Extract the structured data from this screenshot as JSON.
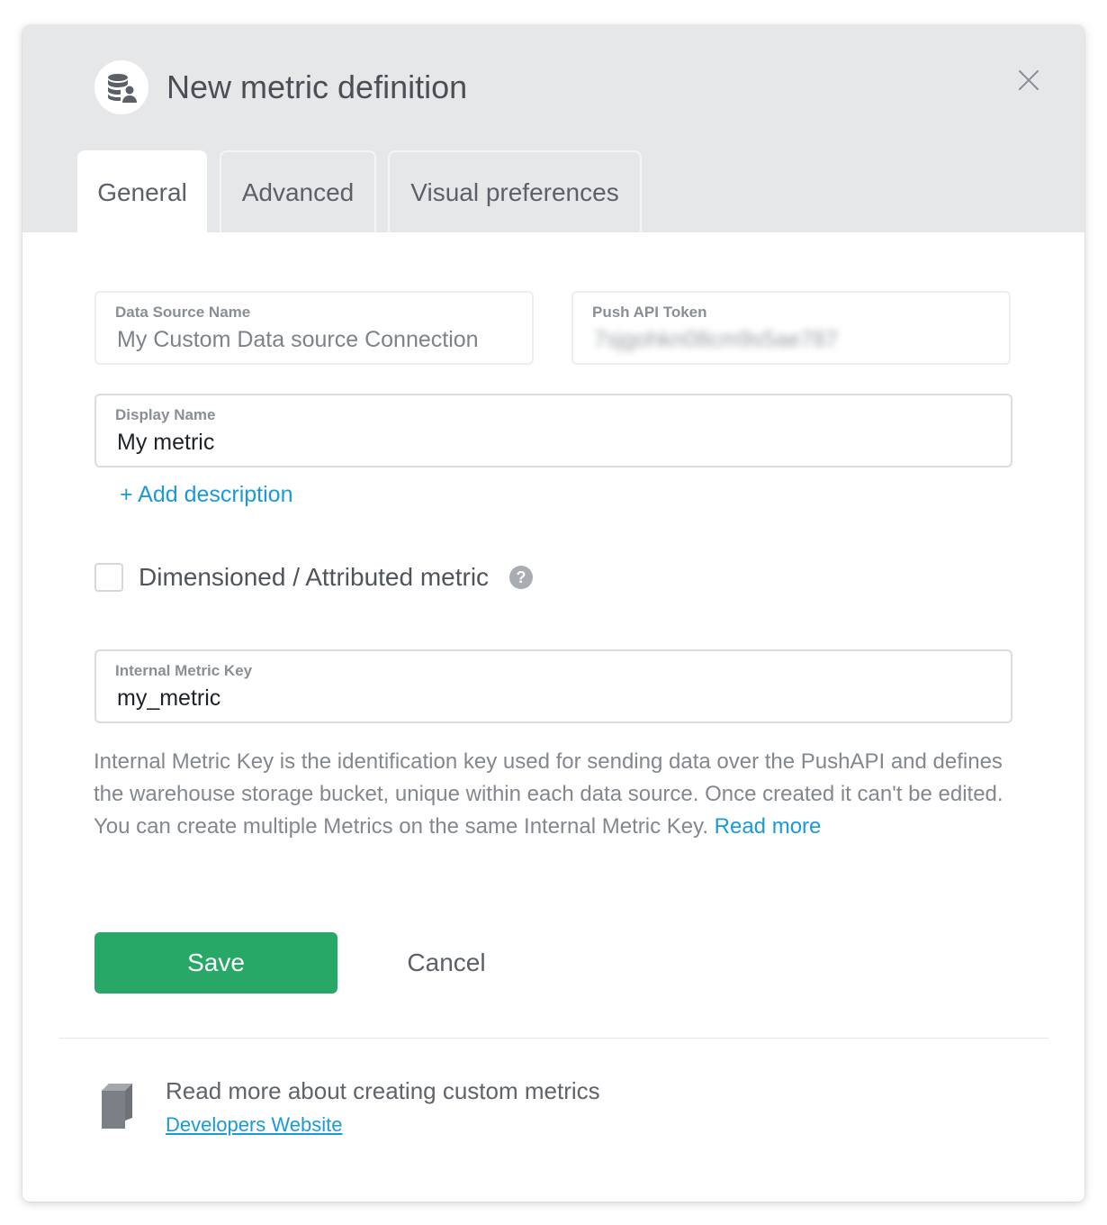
{
  "modal": {
    "title": "New metric definition",
    "icon": "database-user-icon",
    "close_icon": "close-icon"
  },
  "tabs": [
    {
      "label": "General",
      "active": true
    },
    {
      "label": "Advanced",
      "active": false
    },
    {
      "label": "Visual preferences",
      "active": false
    }
  ],
  "fields": {
    "data_source_name": {
      "label": "Data Source Name",
      "value": "My Custom Data source Connection"
    },
    "push_api_token": {
      "label": "Push API Token",
      "value": "7sjgohkn08cm9s5ae787"
    },
    "display_name": {
      "label": "Display Name",
      "value": "My metric"
    },
    "internal_metric_key": {
      "label": "Internal Metric Key",
      "value": "my_metric"
    }
  },
  "add_description": "+ Add description",
  "dimensioned": {
    "label": "Dimensioned / Attributed metric",
    "checked": false,
    "help_icon": "question-circle-icon"
  },
  "help": {
    "text": "Internal Metric Key is the identification key used for sending data over the PushAPI and defines the warehouse storage bucket, unique within each data source. Once created it can't be edited. You can create multiple Metrics on the same Internal Metric Key. ",
    "link": "Read more"
  },
  "actions": {
    "save": "Save",
    "cancel": "Cancel"
  },
  "footer": {
    "icon": "book-icon",
    "text": "Read more about creating custom metrics",
    "link": "Developers Website"
  },
  "colors": {
    "primary": "#27a866",
    "link": "#1a9ad6",
    "header_bg": "#e6e7e9"
  }
}
